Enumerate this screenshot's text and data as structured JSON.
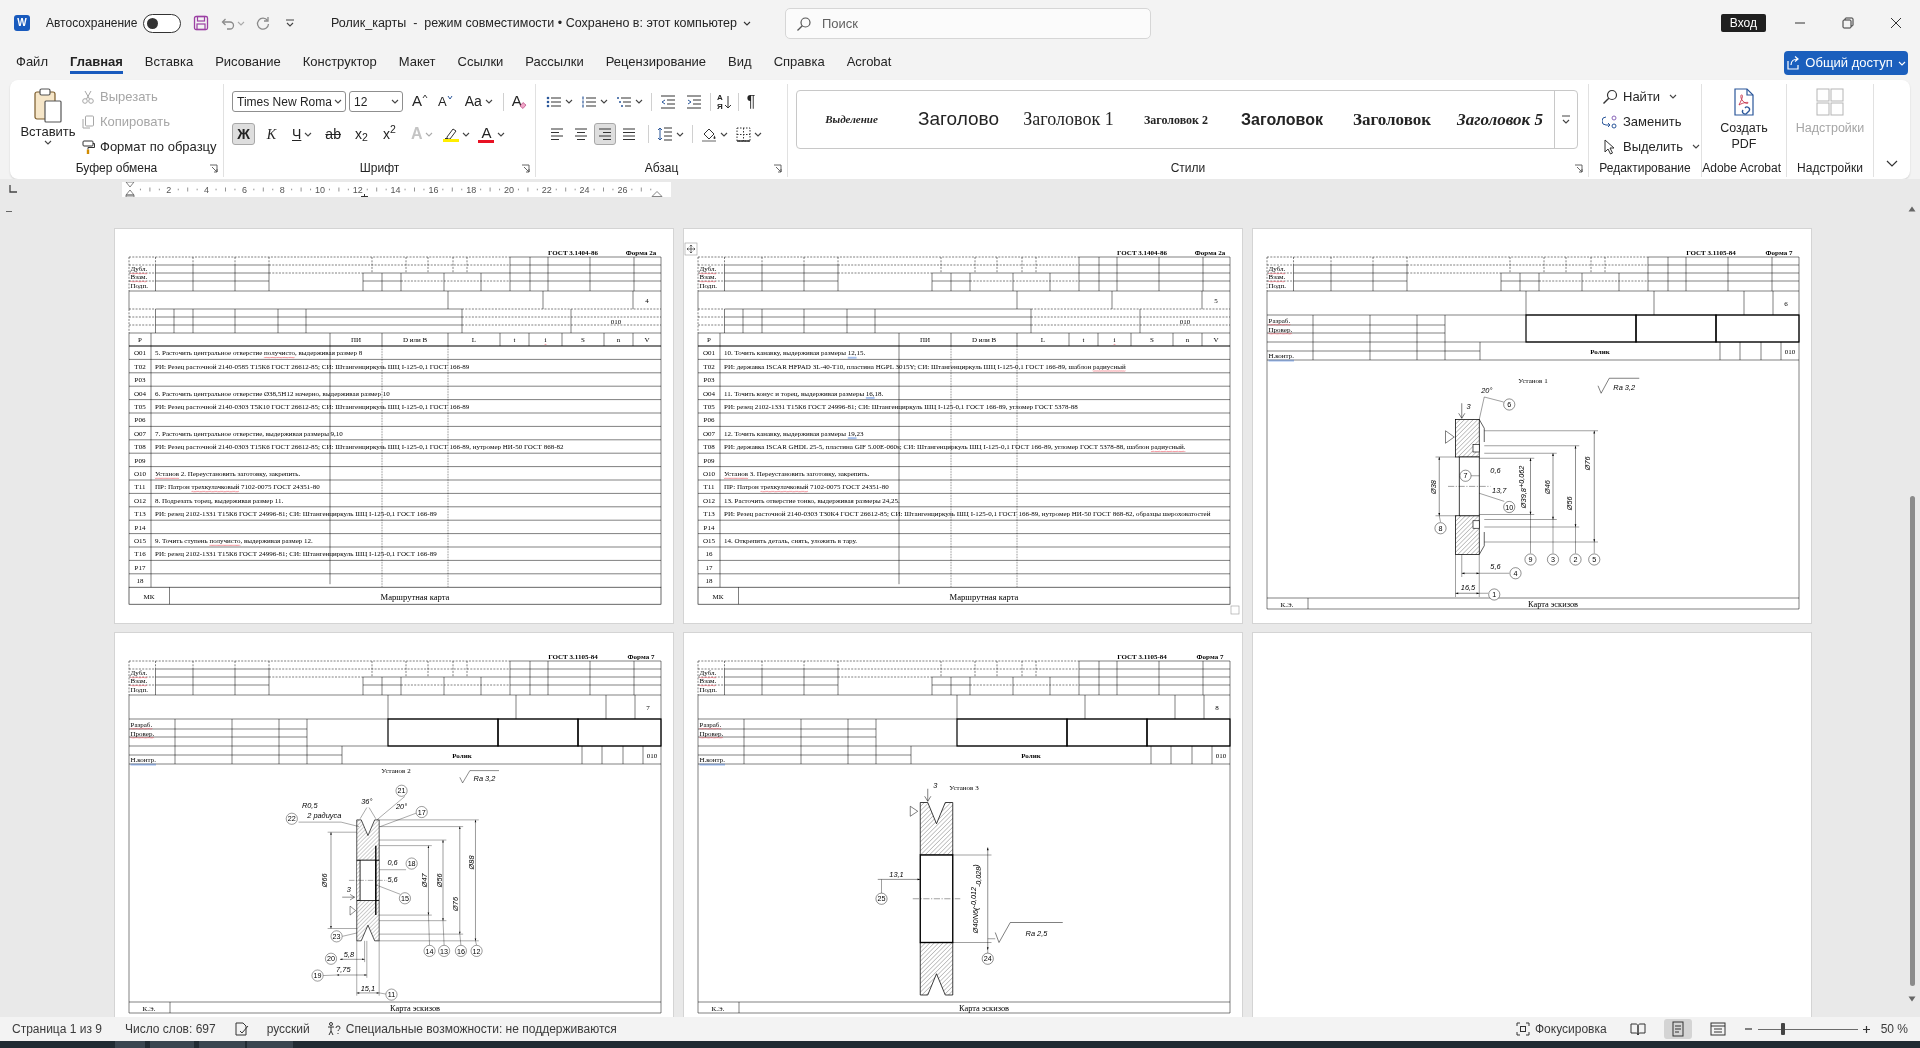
{
  "title_bar": {
    "logo": "W",
    "autosave": {
      "label": "Автосохранение",
      "on": false
    },
    "title": "Ролик_карты  -  режим совместимости • Сохранено в: этот компьютер",
    "search": {
      "placeholder": "Поиск"
    },
    "sign_in": "Вход"
  },
  "menu": {
    "tabs": [
      {
        "label": "Файл",
        "selected": false
      },
      {
        "label": "Главная",
        "selected": true
      },
      {
        "label": "Вставка",
        "selected": false
      },
      {
        "label": "Рисование",
        "selected": false
      },
      {
        "label": "Конструктор",
        "selected": false
      },
      {
        "label": "Макет",
        "selected": false
      },
      {
        "label": "Ссылки",
        "selected": false
      },
      {
        "label": "Рассылки",
        "selected": false
      },
      {
        "label": "Рецензирование",
        "selected": false
      },
      {
        "label": "Вид",
        "selected": false
      },
      {
        "label": "Справка",
        "selected": false
      },
      {
        "label": "Acrobat",
        "selected": false
      }
    ],
    "share": "Общий доступ"
  },
  "ribbon": {
    "clipboard": {
      "title": "Буфер обмена",
      "paste": "Вставить",
      "items": [
        {
          "kind": "cut",
          "label": "Вырезать",
          "disabled": true
        },
        {
          "kind": "copy",
          "label": "Копировать",
          "disabled": true
        },
        {
          "kind": "painter",
          "label": "Формат по образцу",
          "disabled": false
        }
      ]
    },
    "font": {
      "title": "Шрифт",
      "name": "Times New Roma",
      "size": "12",
      "grow": "A",
      "shrink": "A",
      "case": "Aa",
      "clear": "A",
      "toggles": [
        {
          "kind": "bold",
          "glyph": "Ж",
          "on": true
        },
        {
          "kind": "italic",
          "glyph": "К",
          "on": false
        },
        {
          "kind": "underline",
          "glyph": "Ч",
          "on": false
        },
        {
          "kind": "strikethrough",
          "glyph": "ab",
          "on": false
        },
        {
          "kind": "subscript",
          "glyph": "x$_{2}$",
          "on": false
        },
        {
          "kind": "superscript",
          "glyph": "x$^{2}$",
          "on": false
        }
      ],
      "effects": "A",
      "highlight": {
        "color": "#ffee00"
      },
      "font_color": {
        "glyph": "A",
        "color": "#e81123"
      }
    },
    "paragraph": {
      "title": "Абзац",
      "sort": [
        "А",
        "Я"
      ],
      "pilcrow": "¶",
      "alignment": [
        {
          "kind": "left",
          "selected": false
        },
        {
          "kind": "center",
          "selected": false
        },
        {
          "kind": "right",
          "selected": true
        },
        {
          "kind": "justify",
          "selected": false
        }
      ]
    },
    "styles": {
      "title": "Стили",
      "items": [
        {
          "kind": "emphasis",
          "label": "Выделение"
        },
        {
          "kind": "title",
          "label": "Заголово"
        },
        {
          "kind": "h1",
          "label": "Заголовок 1"
        },
        {
          "kind": "h2",
          "label": "Заголовок 2"
        },
        {
          "kind": "h3",
          "label": "Заголовок"
        },
        {
          "kind": "h4",
          "label": "Заголовок"
        },
        {
          "kind": "h5",
          "label": "Заголовок 5"
        }
      ]
    },
    "editing": {
      "title": "Редактирование",
      "items": [
        {
          "kind": "find",
          "label": "Найти",
          "dropdown": true
        },
        {
          "kind": "replace",
          "label": "Заменить",
          "dropdown": false
        },
        {
          "kind": "select",
          "label": "Выделить",
          "dropdown": true
        }
      ]
    },
    "acrobat": {
      "title": "Adobe Acrobat",
      "button": "Создать PDF"
    },
    "addins": {
      "title": "Надстройки",
      "button": {
        "label": "Надстройки",
        "disabled": true
      }
    }
  },
  "ruler": {
    "labels": [
      "2",
      "4",
      "6",
      "8",
      "10",
      "12",
      "14",
      "16",
      "18",
      "20",
      "22",
      "24",
      "26"
    ]
  },
  "pages": [
    {
      "kind": "route_card",
      "table_handles": false,
      "standard": "ГОСТ 3.1404-86",
      "form": "Форма 2а",
      "stamp": [
        {
          "text": "Дубл.",
          "misspelled": true
        },
        {
          "text": "Взам.",
          "misspelled": true
        },
        {
          "text": "Подп."
        }
      ],
      "sheet": "4",
      "operation": "010",
      "columns": [
        {
          "text": "Р"
        },
        {
          "text": "ПИ"
        },
        {
          "text": "D или B"
        },
        {
          "text": "L"
        },
        {
          "text": "t"
        },
        {
          "text": "i",
          "misspelled": true
        },
        {
          "text": "S"
        },
        {
          "text": "n"
        },
        {
          "text": "V"
        }
      ],
      "rows": [
        {
          "code": "О01",
          "parts": [
            {
              "text": "5. Расточить центральное отверстие "
            },
            {
              "text": "получисто",
              "misspelled": true
            },
            {
              "text": ", выдерживая размер 8"
            }
          ]
        },
        {
          "code": "Т02",
          "parts": [
            {
              "text": "РИ: Резец расточной 2140-0585 Т15К6 ГОСТ 26612-85; СИ: Штангенциркуль ШЦ I-125-0,1 ГОСТ 166-89"
            }
          ]
        },
        {
          "code": "Р03"
        },
        {
          "code": "О04",
          "parts": [
            {
              "text": "6. Расточить центральное отверстие Ø38,5H12 начерно, выдерживая размер 10"
            }
          ]
        },
        {
          "code": "Т05",
          "parts": [
            {
              "text": "РИ: Резец расточной 2140-0303 Т5К10 ГОСТ 26612-85; СИ: Штангенциркуль ШЦ I-125-0,1 ГОСТ 166-89"
            }
          ]
        },
        {
          "code": "Р06"
        },
        {
          "code": "О07",
          "parts": [
            {
              "text": "7. Расточить центральное отверстие, выдерживая размеры 9,10"
            }
          ]
        },
        {
          "code": "Т08",
          "parts": [
            {
              "text": "РИ: Резец расточной 2140-0303 Т15К6 ГОСТ 26612-85; СИ: Штангенциркуль ШЦ I-125-0,1 ГОСТ 166-89, нутромер НИ-50 ГОСТ 868-82"
            }
          ]
        },
        {
          "code": "Р09"
        },
        {
          "code": "О10",
          "parts": [
            {
              "text": "Установ",
              "misspelled": true
            },
            {
              "text": " 2. Переустановить заготовку, закрепить."
            }
          ]
        },
        {
          "code": "Т11",
          "parts": [
            {
              "text": "ПР: Патрон "
            },
            {
              "text": "трехкулачковый",
              "misspelled": true
            },
            {
              "text": " 7102-0075 ГОСТ 24351-80"
            }
          ]
        },
        {
          "code": "О12",
          "parts": [
            {
              "text": "8. Подрезать торец, выдерживая размер 11."
            }
          ]
        },
        {
          "code": "Т13",
          "parts": [
            {
              "text": "РИ: резец 2102-1331 Т15К6 ГОСТ 24996-81; СИ: Штангенциркуль ШЦ I-125-0,1 ГОСТ 166-89"
            }
          ]
        },
        {
          "code": "Р14"
        },
        {
          "code": "О15",
          "parts": [
            {
              "text": "9. Точить ступень "
            },
            {
              "text": "получисто",
              "misspelled": true
            },
            {
              "text": ", выдерживая размер 12."
            }
          ]
        },
        {
          "code": "Т16",
          "parts": [
            {
              "text": "РИ: резец 2102-1331 Т15К6 ГОСТ 24996-81; СИ: Штангенциркуль ШЦ I-125-0,1 ГОСТ 166-89"
            }
          ]
        },
        {
          "code": "Р17"
        },
        {
          "code": "18"
        }
      ],
      "code": "МК",
      "title": "Маршрутная карта"
    },
    {
      "kind": "route_card",
      "table_handles": true,
      "standard": "ГОСТ 3.1404-86",
      "form": "Форма 2а",
      "stamp": [
        {
          "text": "Дубл.",
          "misspelled": true
        },
        {
          "text": "Взам.",
          "misspelled": true
        },
        {
          "text": "Подп."
        }
      ],
      "sheet": "5",
      "operation": "010",
      "columns": [
        {
          "text": "Р"
        },
        {
          "text": "ПИ"
        },
        {
          "text": "D или B"
        },
        {
          "text": "L"
        },
        {
          "text": "t"
        },
        {
          "text": "i",
          "misspelled": true
        },
        {
          "text": "S"
        },
        {
          "text": "n"
        },
        {
          "text": "V"
        }
      ],
      "rows": [
        {
          "code": "О01",
          "parts": [
            {
              "text": "10. Точить канавку, выдерживая размеры "
            },
            {
              "text": "12,",
              "grammar_error": true
            },
            {
              "text": "15."
            }
          ]
        },
        {
          "code": "Т02",
          "parts": [
            {
              "text": "РИ: державка ISCAR HFPAD 3L-40-T10, пластина HGPL 3015Y; СИ: Штангенциркуль ШЦ I-125-0,1 ГОСТ 166-89, шаблон "
            },
            {
              "text": "радиусный",
              "misspelled": true
            }
          ]
        },
        {
          "code": "Р03"
        },
        {
          "code": "О04",
          "parts": [
            {
              "text": "11. Точить конус и торец, выдерживая размеры "
            },
            {
              "text": "16,",
              "grammar_error": true
            },
            {
              "text": "18."
            }
          ]
        },
        {
          "code": "Т05",
          "parts": [
            {
              "text": "РИ: резец 2102-1331 Т15К6 ГОСТ 24996-81; СИ: Штангенциркуль ШЦ I-125-0,1 ГОСТ 166-89, угломер ГОСТ 5378-88"
            }
          ]
        },
        {
          "code": "Р06"
        },
        {
          "code": "О07",
          "parts": [
            {
              "text": "12. Точить канавку, выдерживая размеры "
            },
            {
              "text": "19,",
              "grammar_error": true
            },
            {
              "text": "23"
            }
          ]
        },
        {
          "code": "Т08",
          "parts": [
            {
              "text": "РИ: державка ISCAR GHDL 25-5, пластина GIF 5.00E-060s; СИ: Штангенциркуль ШЦ I-125-0,1 ГОСТ 166-89, угломер ГОСТ 5378-88, шаблон "
            },
            {
              "text": "радиусный.",
              "misspelled": true
            }
          ]
        },
        {
          "code": "Р09"
        },
        {
          "code": "О10",
          "parts": [
            {
              "text": "Установ",
              "misspelled": true
            },
            {
              "text": " 3. Переустановить заготовку, закрепить."
            }
          ]
        },
        {
          "code": "Т11",
          "parts": [
            {
              "text": "ПР: Патрон "
            },
            {
              "text": "трехкулачковый",
              "misspelled": true
            },
            {
              "text": " 7102-0075 ГОСТ 24351-80"
            }
          ]
        },
        {
          "code": "О12",
          "parts": [
            {
              "text": "13. Расточить отверстие тонко, выдерживая размеры 24,25."
            }
          ]
        },
        {
          "code": "Т13",
          "parts": [
            {
              "text": "РИ: Резец расточной 2140-0303 Т30К4 ГОСТ 26612-85; СИ: Штангенциркуль ШЦ I-125-0,1 ГОСТ 166-89, нутромер НИ-50 ГОСТ 868-82, образцы шероховатостей"
            }
          ]
        },
        {
          "code": "Р14"
        },
        {
          "code": "О15",
          "parts": [
            {
              "text": "14. Открепить деталь, снять, уложить в тару."
            }
          ]
        },
        {
          "code": "16"
        },
        {
          "code": "17"
        },
        {
          "code": "18"
        }
      ],
      "code": "МК",
      "title": "Маршрутная карта"
    },
    {
      "kind": "sketch_card",
      "table_handles": false,
      "standard": "ГОСТ 3.1105-84",
      "form": "Форма 7",
      "stamp": [
        {
          "text": "Дубл.",
          "misspelled": true
        },
        {
          "text": "Взам.",
          "misspelled": true
        },
        {
          "text": "Подп."
        }
      ],
      "sheet": "6",
      "signatures": [
        {
          "text": "Разраб.",
          "misspelled": true
        },
        {
          "text": "Провер.",
          "misspelled": true
        },
        {
          "text": "Н.контр.",
          "grammar_error": true
        }
      ],
      "part_name": "Ролик",
      "operation": "010",
      "sketch": {
        "kind": "setup_1",
        "setup": "Установ 1",
        "roughness": "Ra 3,2",
        "labels": [
          {
            "text": "20°"
          },
          {
            "text": "3"
          },
          {
            "text": "0,6"
          },
          {
            "text": "13,7"
          },
          {
            "text": "Ø39,8",
            "upper": "+0,062"
          },
          {
            "text": "Ø46"
          },
          {
            "text": "Ø56"
          },
          {
            "text": "Ø76"
          },
          {
            "text": "Ø38"
          },
          {
            "text": "5,6"
          },
          {
            "text": "16,5"
          }
        ],
        "callouts": [
          "6",
          "7",
          "10",
          "8",
          "9",
          "3",
          "2",
          "5",
          "4",
          "1"
        ]
      },
      "code": "К.Э.",
      "title": "Карта эскизов"
    },
    {
      "kind": "sketch_card",
      "table_handles": false,
      "standard": "ГОСТ 3.1105-84",
      "form": "Форма 7",
      "stamp": [
        {
          "text": "Дубл.",
          "misspelled": true
        },
        {
          "text": "Взам.",
          "misspelled": true
        },
        {
          "text": "Подп."
        }
      ],
      "sheet": "7",
      "signatures": [
        {
          "text": "Разраб.",
          "misspelled": true
        },
        {
          "text": "Провер.",
          "misspelled": true
        },
        {
          "text": "Н.контр.",
          "grammar_error": true
        }
      ],
      "part_name": "Ролик",
      "operation": "010",
      "sketch": {
        "kind": "setup_2",
        "setup": "Установ 2",
        "roughness": "Ra 3,2",
        "labels": [
          {
            "text": "R0,5"
          },
          {
            "text": "2 радиуса"
          },
          {
            "text": "36°"
          },
          {
            "text": "20°"
          },
          {
            "text": "0,6"
          },
          {
            "text": "5,6"
          },
          {
            "text": "Ø47"
          },
          {
            "text": "Ø56"
          },
          {
            "text": "Ø76"
          },
          {
            "text": "Ø88"
          },
          {
            "text": "Ø66"
          },
          {
            "text": "3"
          },
          {
            "text": "5,8"
          },
          {
            "text": "7,75"
          },
          {
            "text": "15,1"
          }
        ],
        "callouts": [
          "21",
          "22",
          "17",
          "18",
          "15",
          "23",
          "20",
          "19",
          "11",
          "14",
          "13",
          "16",
          "12"
        ]
      },
      "code": "К.Э.",
      "title": "Карта эскизов"
    },
    {
      "kind": "sketch_card",
      "table_handles": false,
      "standard": "ГОСТ 3.1105-84",
      "form": "Форма 7",
      "stamp": [
        {
          "text": "Дубл.",
          "misspelled": true
        },
        {
          "text": "Взам.",
          "misspelled": true
        },
        {
          "text": "Подп."
        }
      ],
      "sheet": "8",
      "signatures": [
        {
          "text": "Разраб.",
          "misspelled": true
        },
        {
          "text": "Провер.",
          "misspelled": true
        },
        {
          "text": "Н.контр.",
          "grammar_error": true
        }
      ],
      "part_name": "Ролик",
      "operation": "010",
      "sketch": {
        "kind": "setup_3",
        "setup": "Установ 3",
        "roughness": "Ra 2,5",
        "labels": [
          {
            "text": "3"
          },
          {
            "text": "13,1"
          },
          {
            "text": "Ø40N6(",
            "upper": "-0,012",
            "lower": "-0,028",
            "suffix": ")"
          }
        ],
        "callouts": [
          "25",
          "24"
        ]
      },
      "code": "К.Э.",
      "title": "Карта эскизов"
    },
    {
      "kind": "blank",
      "table_handles": false
    }
  ],
  "status_bar": {
    "page": "Страница 1 из 9",
    "words": "Число слов: 697",
    "language": "русский",
    "accessibility": "Специальные возможности: не поддерживаются",
    "focus": "Фокусировка",
    "views": [
      {
        "kind": "read",
        "selected": false
      },
      {
        "kind": "print",
        "selected": true
      },
      {
        "kind": "web",
        "selected": false
      }
    ],
    "zoom": {
      "level": 0.25,
      "label": "50 %"
    }
  }
}
